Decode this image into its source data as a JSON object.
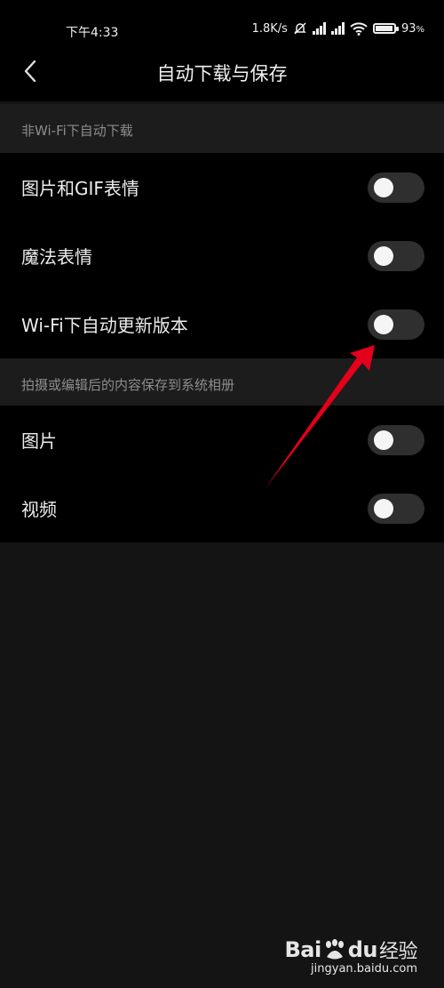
{
  "status_bar": {
    "time": "下午4:33",
    "net_speed": "1.8K/s",
    "battery": "93",
    "battery_unit": "%",
    "battery_level": 0.93
  },
  "header": {
    "title": "自动下载与保存"
  },
  "sections": [
    {
      "title": "非Wi-Fi下自动下载",
      "items": [
        {
          "label": "图片和GIF表情",
          "on": false
        },
        {
          "label": "魔法表情",
          "on": false
        },
        {
          "label": "Wi-Fi下自动更新版本",
          "on": false
        }
      ]
    },
    {
      "title": "拍摄或编辑后的内容保存到系统相册",
      "items": [
        {
          "label": "图片",
          "on": false
        },
        {
          "label": "视频",
          "on": false
        }
      ]
    }
  ],
  "watermark": {
    "brand": "Bai",
    "brand2": "du",
    "product": "经验",
    "url": "jingyan.baidu.com"
  },
  "colors": {
    "annotation_arrow": "#e3001b",
    "toggle_off": "#2f2f2f"
  }
}
